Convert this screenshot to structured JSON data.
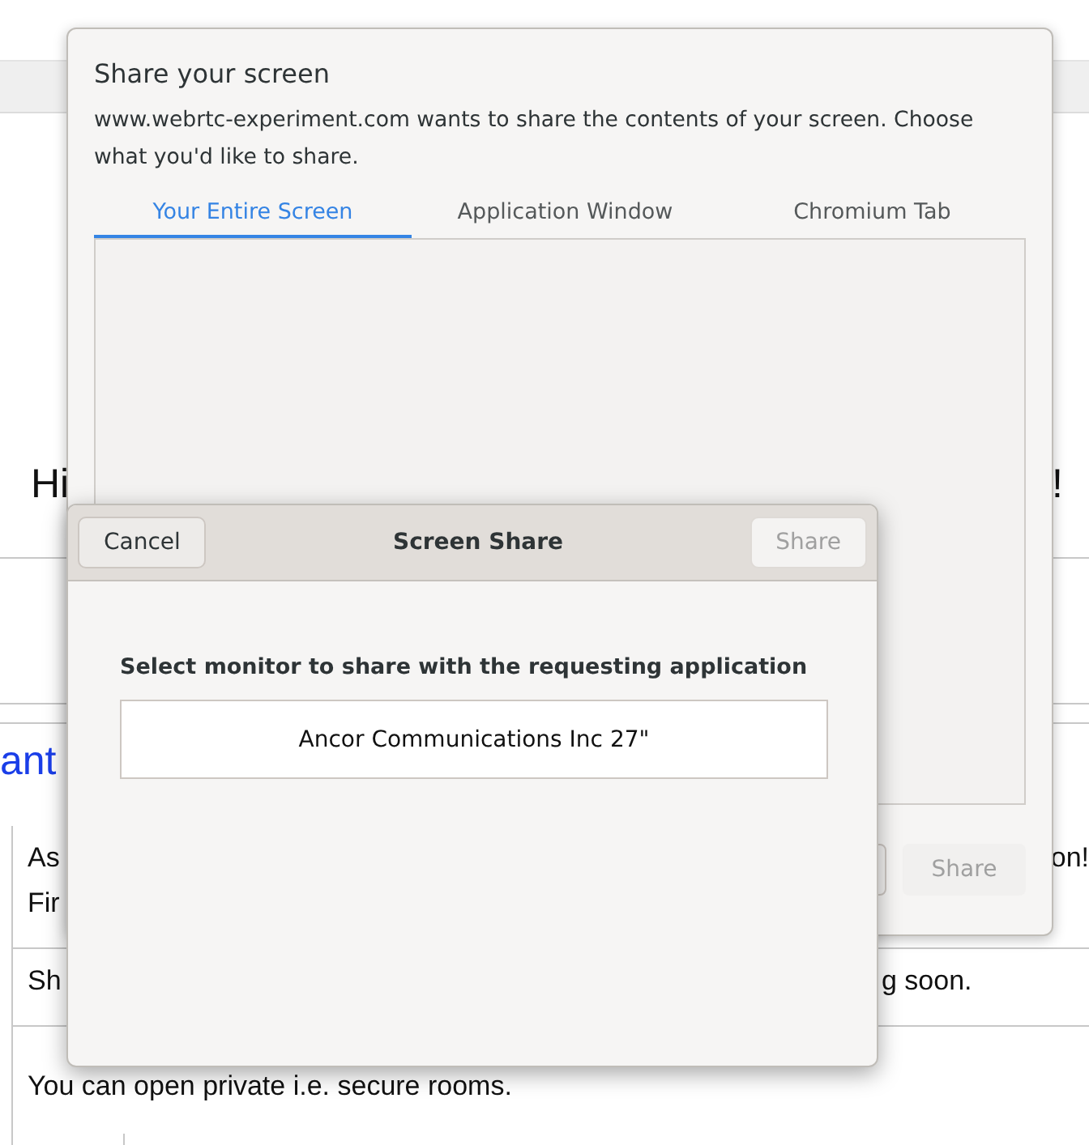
{
  "web_page": {
    "heading_start": "Hi",
    "heading_end": "!",
    "link_fragment": "ant",
    "rows": [
      {
        "lines": [
          {
            "start": "As",
            "end": "on!"
          },
          {
            "start": "Fir"
          }
        ]
      },
      {
        "lines": [
          {
            "start": "Sh",
            "end": "g soon."
          }
        ]
      },
      {
        "lines": [
          {
            "start": "You can open private i.e. secure rooms."
          }
        ]
      }
    ]
  },
  "picker_dialog": {
    "title": "Share your screen",
    "message": "www.webrtc-experiment.com wants to share the contents of your screen. Choose what you'd like to share.",
    "tabs": [
      {
        "label": "Your Entire Screen",
        "selected": true
      },
      {
        "label": "Application Window",
        "selected": false
      },
      {
        "label": "Chromium Tab",
        "selected": false
      }
    ],
    "share_button": {
      "label": "Share",
      "disabled": true
    }
  },
  "portal_dialog": {
    "title": "Screen Share",
    "cancel_button": {
      "label": "Cancel",
      "disabled": false
    },
    "share_button": {
      "label": "Share",
      "disabled": true
    },
    "prompt": "Select monitor to share with the requesting application",
    "monitors": [
      {
        "name": "Ancor Communications Inc 27\"",
        "selected": false
      }
    ]
  }
}
